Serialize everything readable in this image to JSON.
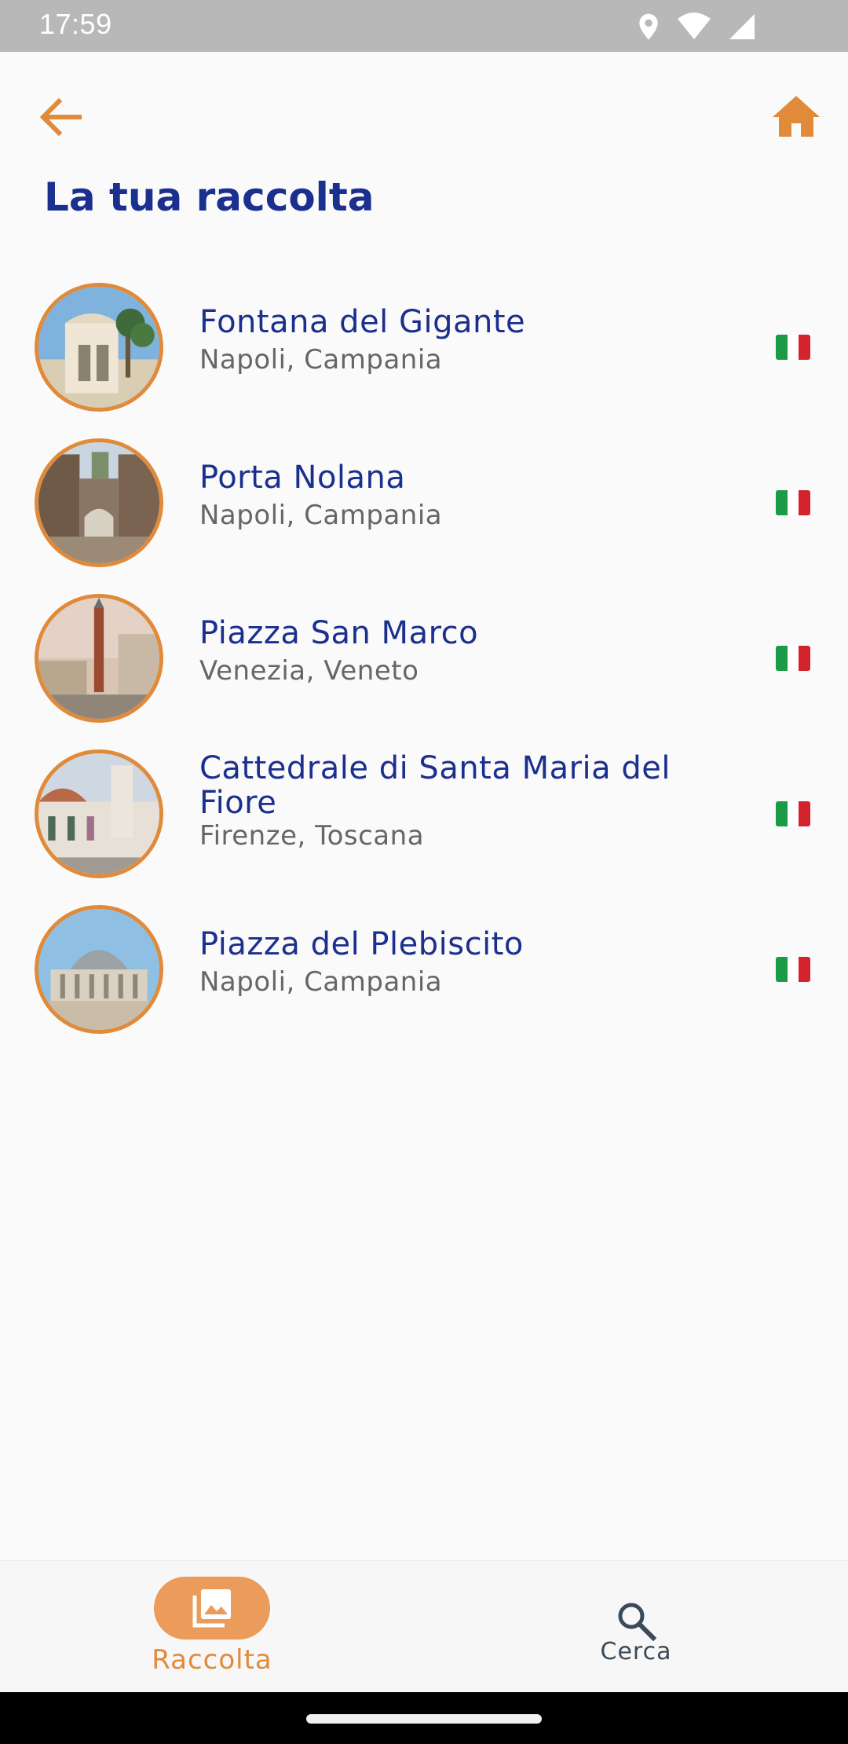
{
  "status_bar": {
    "time": "17:59",
    "icons": [
      "location-icon",
      "wifi-icon",
      "signal-icon"
    ]
  },
  "header": {
    "back_icon": "arrow-left-icon",
    "home_icon": "home-icon",
    "title": "La tua raccolta"
  },
  "colors": {
    "accent": "#e08a3a",
    "title_blue": "#1b2f8e",
    "subtitle_gray": "#666666",
    "nav_pill": "#eb9c5a"
  },
  "collection": {
    "items": [
      {
        "name": "Fontana del Gigante",
        "location": "Napoli, Campania",
        "flag": "italy-flag-icon"
      },
      {
        "name": "Porta Nolana",
        "location": "Napoli, Campania",
        "flag": "italy-flag-icon"
      },
      {
        "name": "Piazza San Marco",
        "location": "Venezia, Veneto",
        "flag": "italy-flag-icon"
      },
      {
        "name": "Cattedrale di Santa Maria del Fiore",
        "location": "Firenze, Toscana",
        "flag": "italy-flag-icon"
      },
      {
        "name": "Piazza del Plebiscito",
        "location": "Napoli, Campania",
        "flag": "italy-flag-icon"
      }
    ]
  },
  "bottom_nav": {
    "items": [
      {
        "label": "Raccolta",
        "icon": "photo-library-icon",
        "active": true
      },
      {
        "label": "Cerca",
        "icon": "search-icon",
        "active": false
      }
    ]
  }
}
